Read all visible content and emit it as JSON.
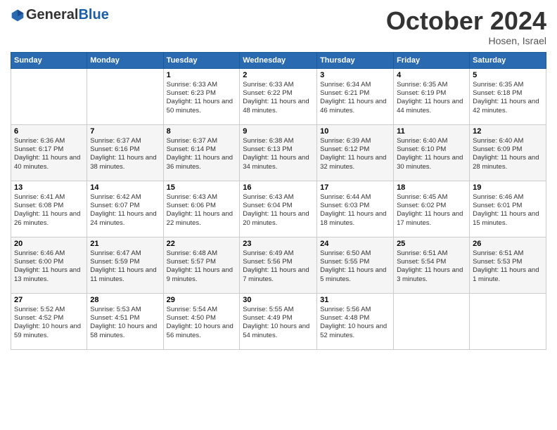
{
  "header": {
    "logo_general": "General",
    "logo_blue": "Blue",
    "month_title": "October 2024",
    "subtitle": "Hosen, Israel"
  },
  "days_of_week": [
    "Sunday",
    "Monday",
    "Tuesday",
    "Wednesday",
    "Thursday",
    "Friday",
    "Saturday"
  ],
  "weeks": [
    [
      {
        "day": "",
        "info": ""
      },
      {
        "day": "",
        "info": ""
      },
      {
        "day": "1",
        "info": "Sunrise: 6:33 AM\nSunset: 6:23 PM\nDaylight: 11 hours and 50 minutes."
      },
      {
        "day": "2",
        "info": "Sunrise: 6:33 AM\nSunset: 6:22 PM\nDaylight: 11 hours and 48 minutes."
      },
      {
        "day": "3",
        "info": "Sunrise: 6:34 AM\nSunset: 6:21 PM\nDaylight: 11 hours and 46 minutes."
      },
      {
        "day": "4",
        "info": "Sunrise: 6:35 AM\nSunset: 6:19 PM\nDaylight: 11 hours and 44 minutes."
      },
      {
        "day": "5",
        "info": "Sunrise: 6:35 AM\nSunset: 6:18 PM\nDaylight: 11 hours and 42 minutes."
      }
    ],
    [
      {
        "day": "6",
        "info": "Sunrise: 6:36 AM\nSunset: 6:17 PM\nDaylight: 11 hours and 40 minutes."
      },
      {
        "day": "7",
        "info": "Sunrise: 6:37 AM\nSunset: 6:16 PM\nDaylight: 11 hours and 38 minutes."
      },
      {
        "day": "8",
        "info": "Sunrise: 6:37 AM\nSunset: 6:14 PM\nDaylight: 11 hours and 36 minutes."
      },
      {
        "day": "9",
        "info": "Sunrise: 6:38 AM\nSunset: 6:13 PM\nDaylight: 11 hours and 34 minutes."
      },
      {
        "day": "10",
        "info": "Sunrise: 6:39 AM\nSunset: 6:12 PM\nDaylight: 11 hours and 32 minutes."
      },
      {
        "day": "11",
        "info": "Sunrise: 6:40 AM\nSunset: 6:10 PM\nDaylight: 11 hours and 30 minutes."
      },
      {
        "day": "12",
        "info": "Sunrise: 6:40 AM\nSunset: 6:09 PM\nDaylight: 11 hours and 28 minutes."
      }
    ],
    [
      {
        "day": "13",
        "info": "Sunrise: 6:41 AM\nSunset: 6:08 PM\nDaylight: 11 hours and 26 minutes."
      },
      {
        "day": "14",
        "info": "Sunrise: 6:42 AM\nSunset: 6:07 PM\nDaylight: 11 hours and 24 minutes."
      },
      {
        "day": "15",
        "info": "Sunrise: 6:43 AM\nSunset: 6:06 PM\nDaylight: 11 hours and 22 minutes."
      },
      {
        "day": "16",
        "info": "Sunrise: 6:43 AM\nSunset: 6:04 PM\nDaylight: 11 hours and 20 minutes."
      },
      {
        "day": "17",
        "info": "Sunrise: 6:44 AM\nSunset: 6:03 PM\nDaylight: 11 hours and 18 minutes."
      },
      {
        "day": "18",
        "info": "Sunrise: 6:45 AM\nSunset: 6:02 PM\nDaylight: 11 hours and 17 minutes."
      },
      {
        "day": "19",
        "info": "Sunrise: 6:46 AM\nSunset: 6:01 PM\nDaylight: 11 hours and 15 minutes."
      }
    ],
    [
      {
        "day": "20",
        "info": "Sunrise: 6:46 AM\nSunset: 6:00 PM\nDaylight: 11 hours and 13 minutes."
      },
      {
        "day": "21",
        "info": "Sunrise: 6:47 AM\nSunset: 5:59 PM\nDaylight: 11 hours and 11 minutes."
      },
      {
        "day": "22",
        "info": "Sunrise: 6:48 AM\nSunset: 5:57 PM\nDaylight: 11 hours and 9 minutes."
      },
      {
        "day": "23",
        "info": "Sunrise: 6:49 AM\nSunset: 5:56 PM\nDaylight: 11 hours and 7 minutes."
      },
      {
        "day": "24",
        "info": "Sunrise: 6:50 AM\nSunset: 5:55 PM\nDaylight: 11 hours and 5 minutes."
      },
      {
        "day": "25",
        "info": "Sunrise: 6:51 AM\nSunset: 5:54 PM\nDaylight: 11 hours and 3 minutes."
      },
      {
        "day": "26",
        "info": "Sunrise: 6:51 AM\nSunset: 5:53 PM\nDaylight: 11 hours and 1 minute."
      }
    ],
    [
      {
        "day": "27",
        "info": "Sunrise: 5:52 AM\nSunset: 4:52 PM\nDaylight: 10 hours and 59 minutes."
      },
      {
        "day": "28",
        "info": "Sunrise: 5:53 AM\nSunset: 4:51 PM\nDaylight: 10 hours and 58 minutes."
      },
      {
        "day": "29",
        "info": "Sunrise: 5:54 AM\nSunset: 4:50 PM\nDaylight: 10 hours and 56 minutes."
      },
      {
        "day": "30",
        "info": "Sunrise: 5:55 AM\nSunset: 4:49 PM\nDaylight: 10 hours and 54 minutes."
      },
      {
        "day": "31",
        "info": "Sunrise: 5:56 AM\nSunset: 4:48 PM\nDaylight: 10 hours and 52 minutes."
      },
      {
        "day": "",
        "info": ""
      },
      {
        "day": "",
        "info": ""
      }
    ]
  ]
}
